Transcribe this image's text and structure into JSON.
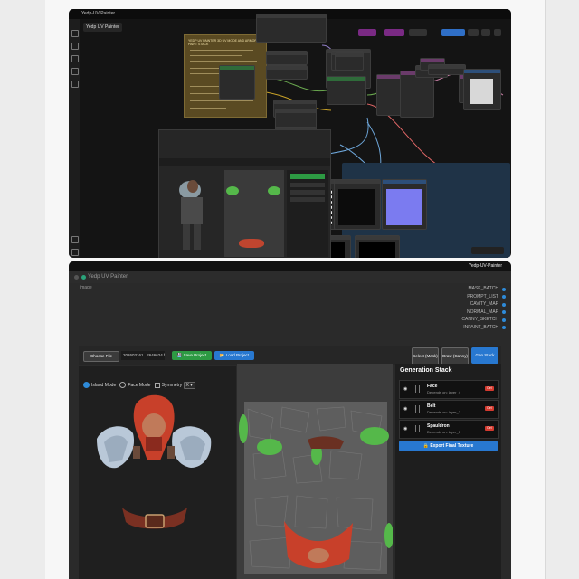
{
  "top_window": {
    "tab_title": "Yedp-UV-Painter",
    "workflow_tab": "Yedp UV Painter",
    "note_title": "YEDP UV PAINTER 3D UV MODE AND ARMOR PAINT STACK"
  },
  "bottom_window": {
    "app_title": "Yedp-UV-Painter",
    "node_title": "Yedp UV Painter",
    "image_label": "image",
    "outputs": [
      "MASK_BATCH",
      "PROMPT_LIST",
      "CAVITY_MAP",
      "NORMAL_MAP",
      "CANNY_SKETCH",
      "INPAINT_BATCH"
    ],
    "toolbar": {
      "choose_file": "Choose File",
      "file_name": "202603161...2646624.fbx",
      "save_project": "Save Project",
      "load_project": "Load Project",
      "select_mask": "Select (Mask)",
      "draw_canny": "Draw (Canny)",
      "gen_stack": "Gen Stack"
    },
    "viewport": {
      "island_mode": "Island Mode",
      "face_mode": "Face Mode",
      "symmetry": "Symmetry",
      "symmetry_axis": "X"
    },
    "stack": {
      "title": "Generation Stack",
      "layers": [
        {
          "name": "Face",
          "depends": "Depends on: layer_4",
          "delete": "Del"
        },
        {
          "name": "Belt",
          "depends": "Depends on: layer_2",
          "delete": "Del"
        },
        {
          "name": "Spauldron",
          "depends": "Depends on: layer_1",
          "delete": "Del"
        }
      ],
      "export": "Export Final Texture"
    },
    "colors": {
      "accent_blue": "#2878d0",
      "save_green": "#2d9a43",
      "delete_red": "#d43a2f",
      "uv_green": "#55b84a"
    }
  }
}
